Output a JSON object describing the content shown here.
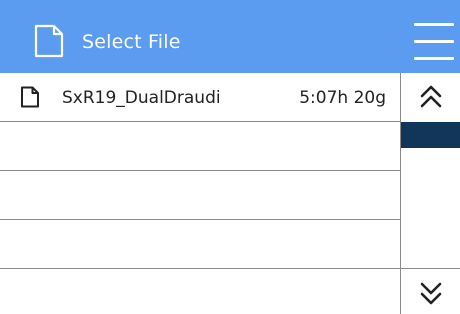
{
  "header": {
    "title": "Select File",
    "file_icon": "file-icon",
    "menu_icon": "hamburger-menu-icon",
    "background_color": "#5b9bf0"
  },
  "files": [
    {
      "name": "SxR19_DualDraudi",
      "meta": "5:07h 20g",
      "icon": "file-icon"
    },
    {
      "name": "",
      "meta": "",
      "icon": ""
    },
    {
      "name": "",
      "meta": "",
      "icon": ""
    },
    {
      "name": "",
      "meta": "",
      "icon": ""
    },
    {
      "name": "",
      "meta": "",
      "icon": ""
    }
  ],
  "scrollbar": {
    "up_icon": "double-chevron-up-icon",
    "down_icon": "double-chevron-down-icon",
    "thumb_color": "#12365a"
  }
}
